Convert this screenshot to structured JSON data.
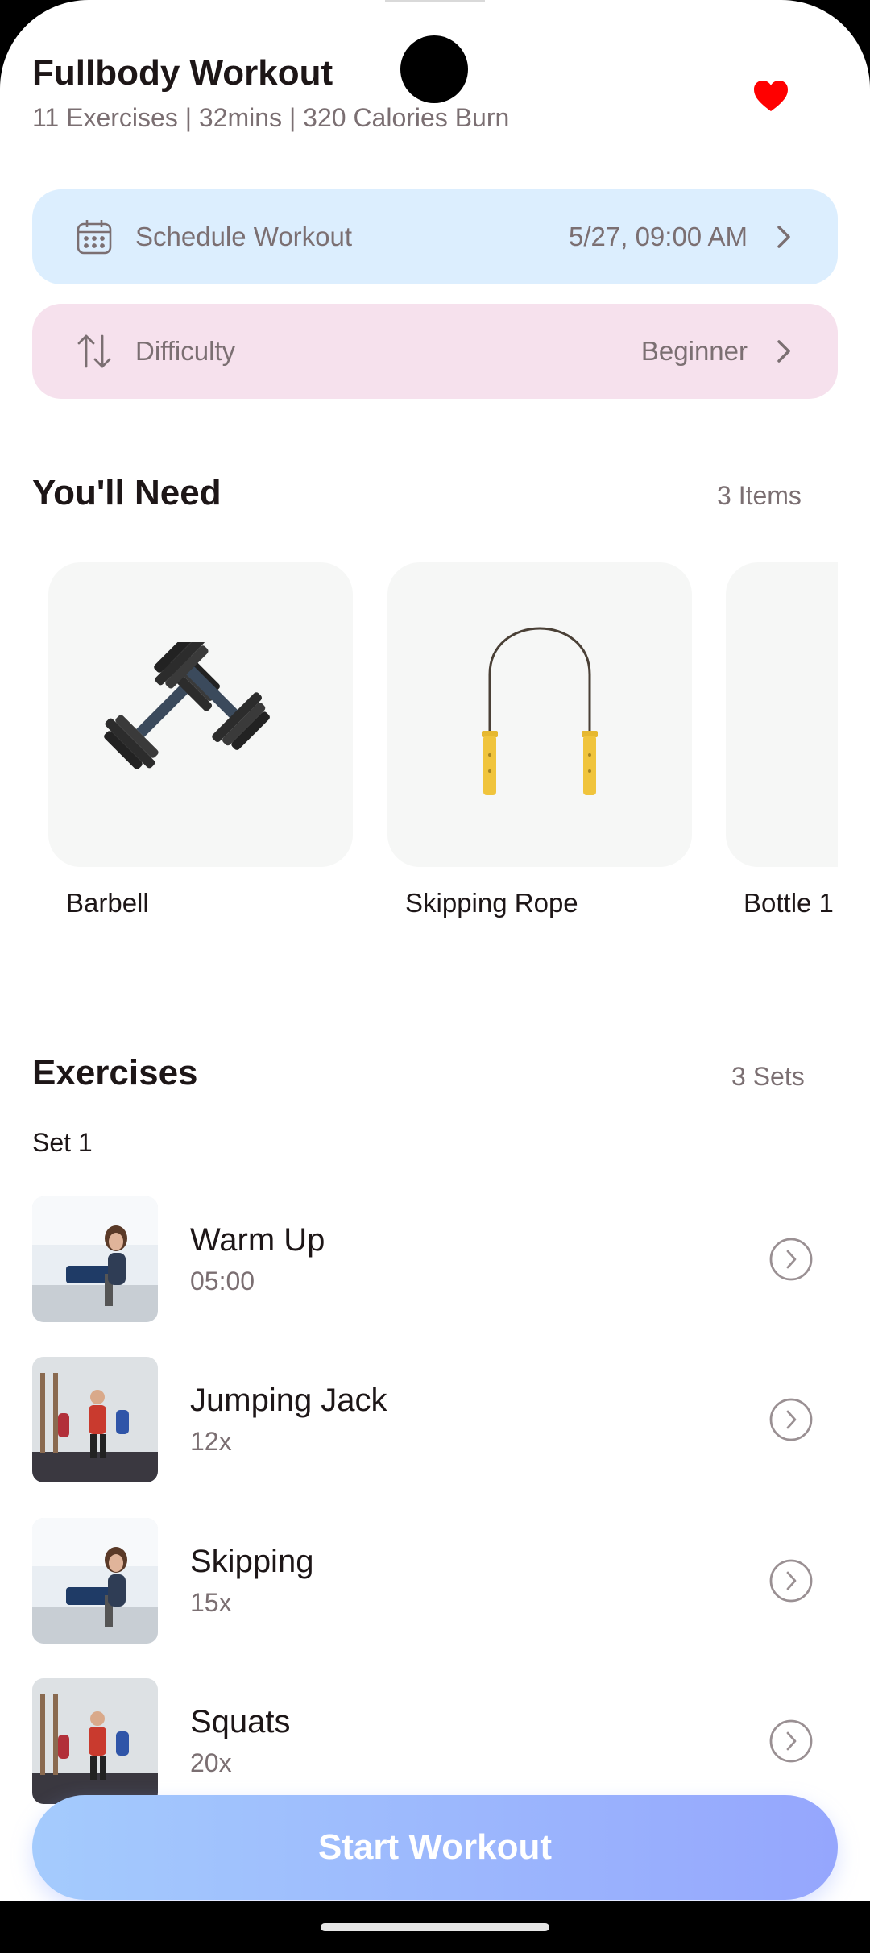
{
  "header": {
    "title": "Fullbody Workout",
    "subtitle": "11 Exercises | 32mins | 320 Calories Burn",
    "favorite_icon": "heart-icon"
  },
  "schedule": {
    "label": "Schedule Workout",
    "value": "5/27, 09:00 AM",
    "icon": "calendar-icon"
  },
  "difficulty": {
    "label": "Difficulty",
    "value": "Beginner",
    "icon": "sort-arrows-icon"
  },
  "need": {
    "title": "You'll Need",
    "count": "3 Items",
    "items": [
      {
        "name": "Barbell",
        "icon": "dumbbell-icon"
      },
      {
        "name": "Skipping Rope",
        "icon": "skipping-rope-icon"
      },
      {
        "name": "Bottle 1",
        "icon": "bottle-icon"
      }
    ]
  },
  "exercises": {
    "title": "Exercises",
    "count": "3 Sets",
    "set_label": "Set 1",
    "items": [
      {
        "name": "Warm Up",
        "meta": "05:00"
      },
      {
        "name": "Jumping Jack",
        "meta": "12x"
      },
      {
        "name": "Skipping",
        "meta": "15x"
      },
      {
        "name": "Squats",
        "meta": "20x"
      }
    ]
  },
  "cta": {
    "label": "Start Workout"
  },
  "colors": {
    "schedule_bg": "#dceefe",
    "difficulty_bg": "#f6e1ed",
    "gradient_start": "#a4cbfd",
    "gradient_end": "#95a6fd",
    "favorite": "#ff0000"
  }
}
